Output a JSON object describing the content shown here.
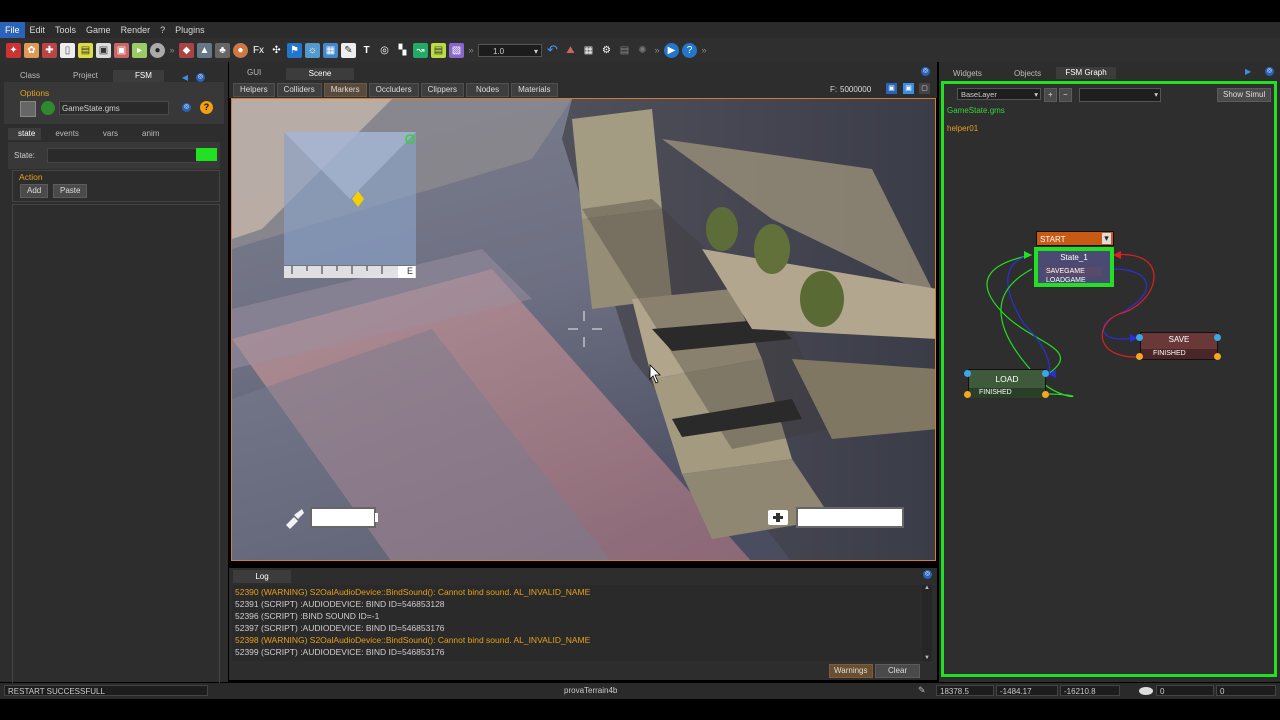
{
  "menu": [
    "File",
    "Edit",
    "Tools",
    "Game",
    "Render",
    "?",
    "Plugins"
  ],
  "toolbar": {
    "zoom_value": "1.0"
  },
  "left_panel": {
    "tabs": [
      "Class",
      "Project",
      "FSM"
    ],
    "options_label": "Options",
    "file_name": "GameState.gms",
    "subtabs": [
      "state",
      "events",
      "vars",
      "anim"
    ],
    "state_label": "State:",
    "action_label": "Action",
    "add_label": "Add",
    "paste_label": "Paste"
  },
  "scene": {
    "tabs": [
      "GUI",
      "Scene"
    ],
    "filters": [
      "Helpers",
      "Colliders",
      "Markers",
      "Occluders",
      "Clippers",
      "Nodes",
      "Materials"
    ],
    "frame_label": "F:",
    "frame_value": "5000000",
    "compass_letter": "E"
  },
  "right_panel": {
    "tabs": [
      "Widgets",
      "Objects",
      "FSM Graph"
    ],
    "layer": "BaseLayer",
    "show_simul": "Show Simul",
    "file": "GameState.gms",
    "helper": "helper01",
    "nodes": {
      "start": "START",
      "state1": "State_1",
      "state1_event1": "SAVEGAME",
      "state1_event2": "LOADGAME",
      "save": "SAVE",
      "save_event": "FINISHED",
      "load": "LOAD",
      "load_event": "FINISHED"
    }
  },
  "log": {
    "tab": "Log",
    "lines": [
      {
        "text": "52390 (WARNING) S2OalAudioDevice::BindSound(): Cannot bind sound. AL_INVALID_NAME",
        "type": "warning"
      },
      {
        "text": "52391 (SCRIPT) :AUDIODEVICE: BIND ID=546853128",
        "type": "normal"
      },
      {
        "text": "52396 (SCRIPT) :BIND SOUND ID=-1",
        "type": "normal"
      },
      {
        "text": "52397 (SCRIPT) :AUDIODEVICE: BIND ID=546853176",
        "type": "normal"
      },
      {
        "text": "52398 (WARNING) S2OalAudioDevice::BindSound(): Cannot bind sound. AL_INVALID_NAME",
        "type": "warning"
      },
      {
        "text": "52399 (SCRIPT) :AUDIODEVICE: BIND ID=546853176",
        "type": "normal"
      }
    ],
    "warnings_label": "Warnings",
    "clear_label": "Clear"
  },
  "status": {
    "message": "RESTART SUCCESSFULL",
    "scene_name": "provaTerrain4b",
    "x": "18378.5",
    "y": "-1484.17",
    "z": "-16210.8",
    "val1": "0",
    "val2": "0"
  },
  "colors": {
    "accent_green": "#22e022",
    "accent_orange": "#d87a2c",
    "warning": "#e4a11b"
  }
}
